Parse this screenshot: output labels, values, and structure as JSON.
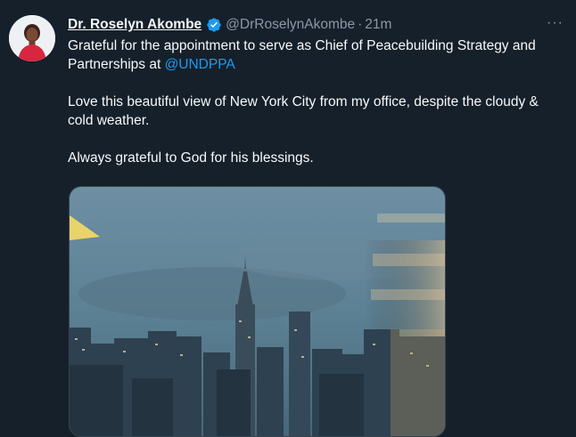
{
  "tweet": {
    "author_name": "Dr. Roselyn Akombe",
    "handle": "@DrRoselynAkombe",
    "separator": "·",
    "time": "21m",
    "more_label": "···",
    "text_line1_prefix": "Grateful for the appointment to serve as Chief of Peacebuilding Strategy and Partnerships at ",
    "mention": "@UNDPPA",
    "text_para2": "Love this beautiful view of New York City from my office, despite the cloudy & cold weather.",
    "text_para3": "Always grateful to God for his blessings.",
    "verified_icon": "verified-badge-icon",
    "accent_color": "#1d9bf0",
    "background_color": "#15202b"
  }
}
